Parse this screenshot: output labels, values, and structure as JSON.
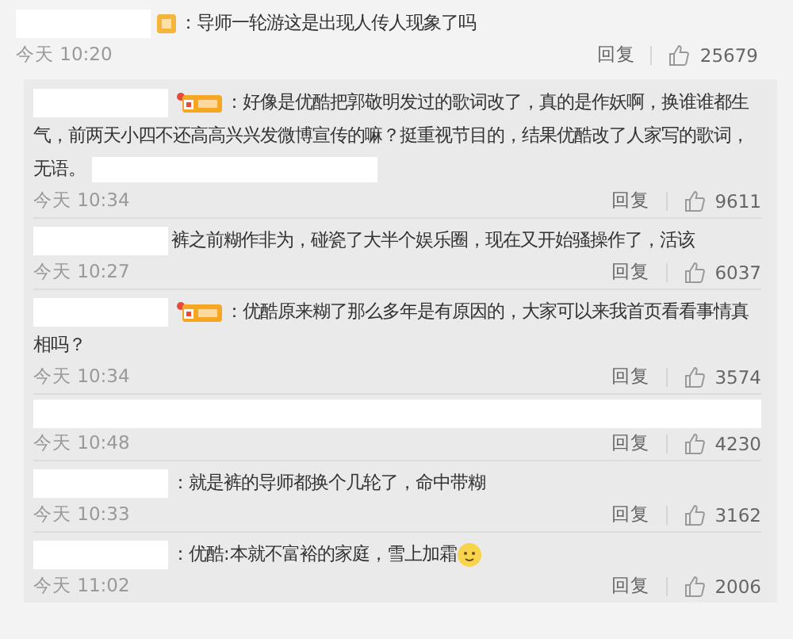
{
  "top_comment": {
    "badge": {
      "kind": "fan"
    },
    "text": "：导师一轮游这是出现人传人现象了吗",
    "time": "今天 10:20",
    "reply": "回复",
    "likes": "25679"
  },
  "replies": [
    {
      "badge": {
        "kind": "iron_fan"
      },
      "text": "：好像是优酷把郭敬明发过的歌词改了，真的是作妖啊，换谁谁都生气，前两天小四不还高高兴兴发微博宣传的嘛？挺重视节目的，结果优酷改了人家写的歌词，无语。",
      "trailing": {
        "kind": "redaction"
      },
      "time": "今天 10:34",
      "reply": "回复",
      "likes": "9611"
    },
    {
      "text": "裤之前糊作非为，碰瓷了大半个娱乐圈，现在又开始骚操作了，活该",
      "time": "今天 10:27",
      "reply": "回复",
      "likes": "6037"
    },
    {
      "badge": {
        "kind": "iron_fan"
      },
      "text": "：优酷原来糊了那么多年是有原因的，大家可以来我首页看看事情真相吗？",
      "time": "今天 10:34",
      "reply": "回复",
      "likes": "3574"
    },
    {
      "time": "今天 10:48",
      "reply": "回复",
      "likes": "4230"
    },
    {
      "text": "：就是裤的导师都换个几轮了，命中带糊",
      "time": "今天 10:33",
      "reply": "回复",
      "likes": "3162"
    },
    {
      "text": "：优酷:本就不富裕的家庭，雪上加霜",
      "trailing": {
        "kind": "emoji"
      },
      "time": "今天 11:02",
      "reply": "回复",
      "likes": "2006"
    }
  ]
}
